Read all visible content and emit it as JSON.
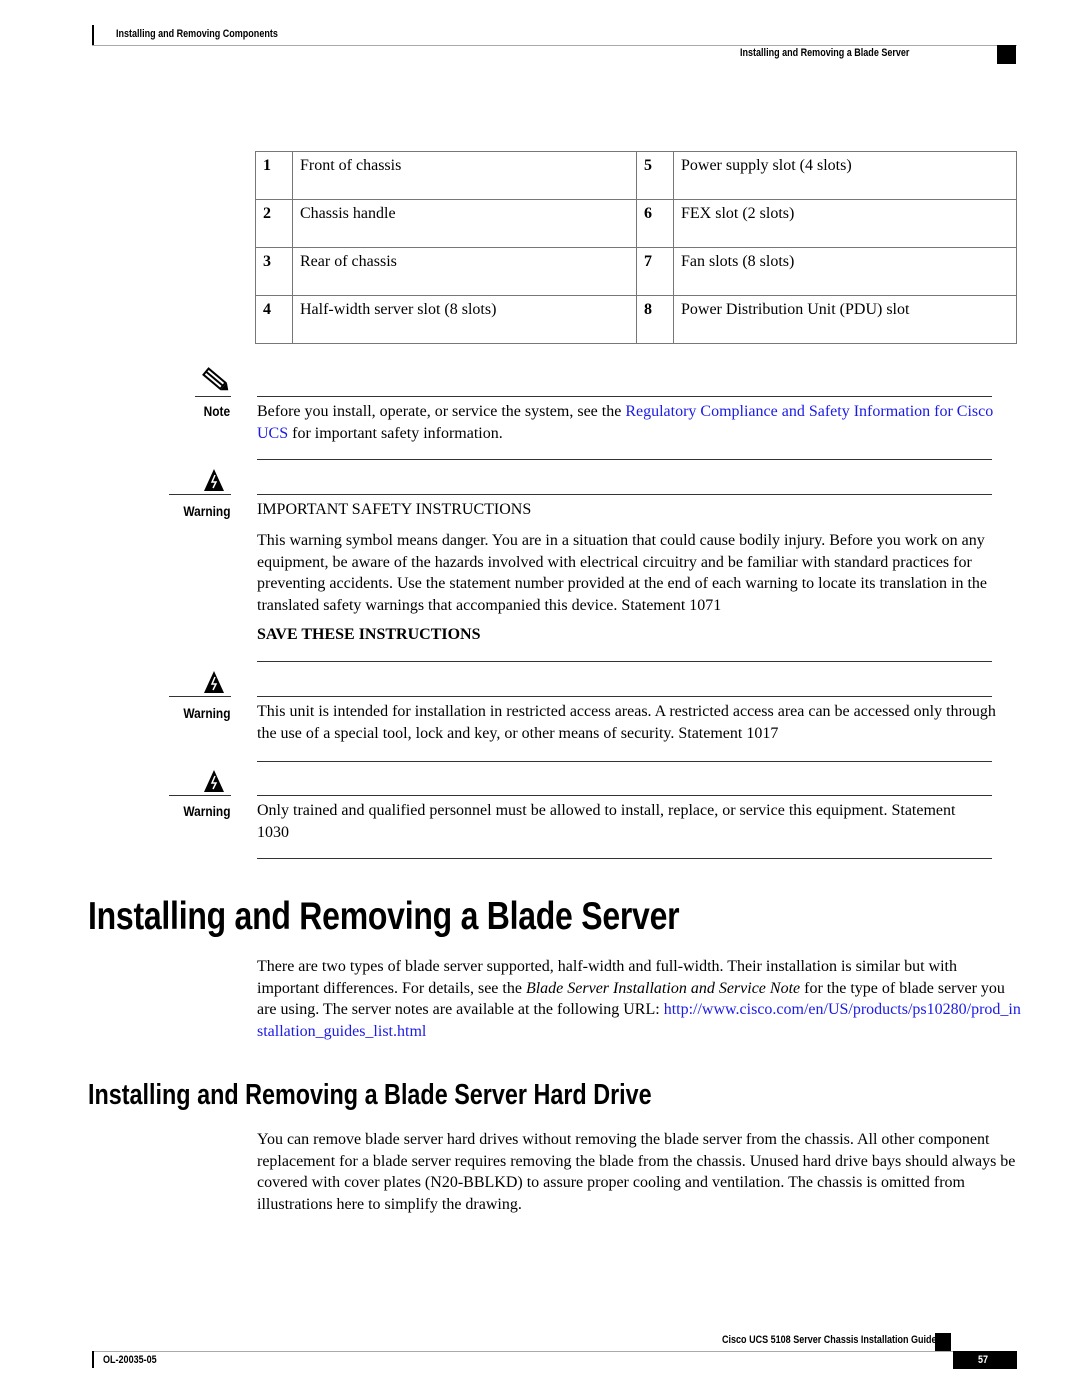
{
  "header": {
    "chapter": "Installing and Removing Components",
    "section": "Installing and Removing a Blade Server"
  },
  "legend_table": {
    "rows": [
      {
        "num_left": "1",
        "text_left": "Front of chassis",
        "num_right": "5",
        "text_right": "Power supply slot (4 slots)"
      },
      {
        "num_left": "2",
        "text_left": "Chassis handle",
        "num_right": "6",
        "text_right": "FEX slot (2 slots)"
      },
      {
        "num_left": "3",
        "text_left": "Rear of chassis",
        "num_right": "7",
        "text_right": "Fan slots (8 slots)"
      },
      {
        "num_left": "4",
        "text_left": "Half-width server slot (8 slots)",
        "num_right": "8",
        "text_right": "Power Distribution Unit (PDU) slot"
      }
    ]
  },
  "note": {
    "icon": "pencil-note-icon",
    "label": "Note",
    "text_before": "Before you install, operate, or service the system, see the ",
    "link_text": "Regulatory Compliance and Safety Information for Cisco UCS",
    "text_after": " for important safety information."
  },
  "warnings": [
    {
      "icon": "warning-lightning-icon",
      "label": "Warning",
      "heading": "IMPORTANT SAFETY INSTRUCTIONS",
      "text": "This warning symbol means danger. You are in a situation that could cause bodily injury. Before you work on any equipment, be aware of the hazards involved with electrical circuitry and be familiar with standard practices for preventing accidents. Use the statement number provided at the end of each warning to locate its translation in the translated safety warnings that accompanied this device.  Statement 1071",
      "footer": "SAVE THESE INSTRUCTIONS"
    },
    {
      "icon": "warning-lightning-icon",
      "label": "Warning",
      "text": "This unit is intended for installation in restricted access areas. A restricted access area can be accessed only through the use of a special tool, lock and key, or other means of security.  Statement 1017"
    },
    {
      "icon": "warning-lightning-icon",
      "label": "Warning",
      "text": "Only trained and qualified personnel must be allowed to install, replace, or service this equipment. Statement 1030"
    }
  ],
  "section1": {
    "title": "Installing and Removing a Blade Server",
    "text_before": "There are two types of blade server supported, half-width and full-width. Their installation is similar but with important differences. For details, see the ",
    "italic": "Blade Server Installation and Service Note",
    "text_middle": " for the type of blade server you are using. The server notes are available at the following URL: ",
    "link_text": "http://www.cisco.com/en/US/products/ps10280/prod_installation_guides_list.html"
  },
  "section2": {
    "title": "Installing and Removing a Blade Server Hard Drive",
    "text": "You can remove blade server hard drives without removing the blade server from the chassis. All other component replacement for a blade server requires removing the blade from the chassis. Unused hard drive bays should always be covered with cover plates (N20-BBLKD) to assure proper cooling and ventilation. The chassis is omitted from illustrations here to simplify the drawing."
  },
  "footer": {
    "guide_title": "Cisco UCS 5108 Server Chassis Installation Guide",
    "doc_number": "OL-20035-05",
    "page_number": "57"
  },
  "colors": {
    "link": "#1a1ae6",
    "text": "#000000"
  }
}
